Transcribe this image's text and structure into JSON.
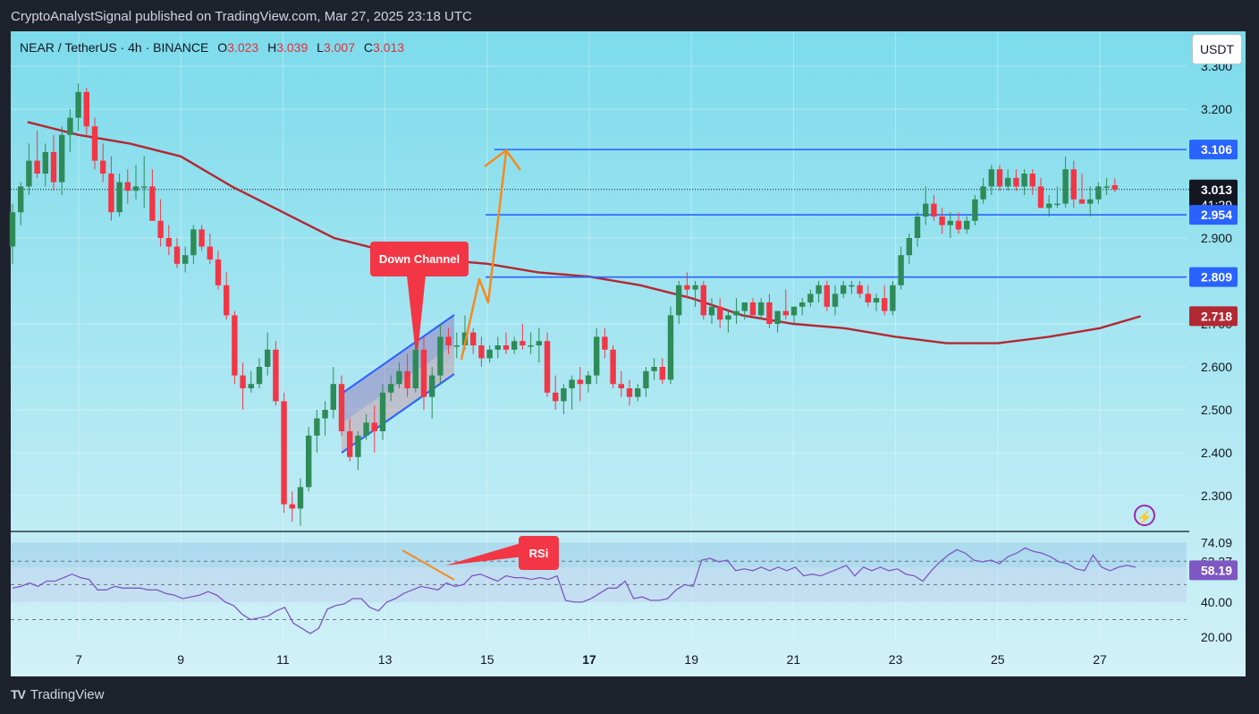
{
  "header": {
    "publisher_line": "CryptoAnalystSignal published on TradingView.com, Mar 27, 2025 23:18 UTC"
  },
  "symbol_info": {
    "pair": "NEAR / TetherUS · 4h · BINANCE",
    "open_label": "O",
    "open": "3.023",
    "high_label": "H",
    "high": "3.039",
    "low_label": "L",
    "low": "3.007",
    "close_label": "C",
    "close": "3.013"
  },
  "unit": "USDT",
  "annotations": {
    "down_channel": "Down Channel",
    "rsi": "RSi"
  },
  "footer": {
    "brand": "TradingView",
    "logo_mark": "TV"
  },
  "colors": {
    "up": "#2e8b57",
    "down": "#f23645",
    "ma": "#b22833",
    "level": "#2962ff",
    "rsi": "#7e57c2",
    "arrow": "#f7891e"
  },
  "chart_data": [
    {
      "type": "candlestick",
      "title": "",
      "x_ticks": [
        "7",
        "9",
        "11",
        "13",
        "15",
        "17",
        "19",
        "21",
        "23",
        "25",
        "27"
      ],
      "y_ticks": [
        "3.300",
        "3.200",
        "2.900",
        "2.700",
        "2.600",
        "2.500",
        "2.400",
        "2.300"
      ],
      "ylim": [
        2.22,
        3.4
      ],
      "horizontal_levels": [
        3.106,
        2.954,
        2.809
      ],
      "price_labels": [
        {
          "value": 3.106,
          "text": "3.106",
          "style": "level"
        },
        {
          "value": 3.013,
          "text": "3.013",
          "sub": "41:29",
          "style": "last"
        },
        {
          "value": 2.954,
          "text": "2.954",
          "style": "level"
        },
        {
          "value": 2.809,
          "text": "2.809",
          "style": "level"
        },
        {
          "value": 2.718,
          "text": "2.718",
          "style": "ma"
        }
      ],
      "last_price": 3.013,
      "countdown": "41:29",
      "candles": [
        [
          2.88,
          2.98,
          2.84,
          2.96
        ],
        [
          2.96,
          3.03,
          2.93,
          3.02
        ],
        [
          3.02,
          3.12,
          3.0,
          3.08
        ],
        [
          3.08,
          3.15,
          3.04,
          3.05
        ],
        [
          3.05,
          3.12,
          3.02,
          3.1
        ],
        [
          3.1,
          3.14,
          3.01,
          3.03
        ],
        [
          3.03,
          3.16,
          3.0,
          3.14
        ],
        [
          3.14,
          3.2,
          3.1,
          3.18
        ],
        [
          3.18,
          3.26,
          3.15,
          3.24
        ],
        [
          3.24,
          3.25,
          3.14,
          3.16
        ],
        [
          3.16,
          3.18,
          3.06,
          3.08
        ],
        [
          3.08,
          3.12,
          3.03,
          3.05
        ],
        [
          3.05,
          3.09,
          2.94,
          2.96
        ],
        [
          2.96,
          3.05,
          2.95,
          3.03
        ],
        [
          3.03,
          3.06,
          2.98,
          3.01
        ],
        [
          3.01,
          3.07,
          2.99,
          3.02
        ],
        [
          3.02,
          3.09,
          2.97,
          3.02
        ],
        [
          3.02,
          3.06,
          2.94,
          2.94
        ],
        [
          2.94,
          2.99,
          2.88,
          2.9
        ],
        [
          2.9,
          2.93,
          2.86,
          2.88
        ],
        [
          2.88,
          2.9,
          2.83,
          2.84
        ],
        [
          2.84,
          2.88,
          2.82,
          2.86
        ],
        [
          2.86,
          2.93,
          2.84,
          2.92
        ],
        [
          2.92,
          2.93,
          2.87,
          2.88
        ],
        [
          2.88,
          2.91,
          2.84,
          2.85
        ],
        [
          2.85,
          2.87,
          2.78,
          2.79
        ],
        [
          2.79,
          2.82,
          2.71,
          2.72
        ],
        [
          2.72,
          2.73,
          2.56,
          2.58
        ],
        [
          2.58,
          2.61,
          2.5,
          2.55
        ],
        [
          2.55,
          2.59,
          2.54,
          2.56
        ],
        [
          2.56,
          2.62,
          2.55,
          2.6
        ],
        [
          2.6,
          2.68,
          2.58,
          2.64
        ],
        [
          2.64,
          2.66,
          2.51,
          2.52
        ],
        [
          2.52,
          2.54,
          2.26,
          2.28
        ],
        [
          2.28,
          2.31,
          2.24,
          2.27
        ],
        [
          2.27,
          2.34,
          2.23,
          2.32
        ],
        [
          2.32,
          2.46,
          2.31,
          2.44
        ],
        [
          2.44,
          2.5,
          2.4,
          2.48
        ],
        [
          2.48,
          2.52,
          2.44,
          2.5
        ],
        [
          2.5,
          2.6,
          2.48,
          2.56
        ],
        [
          2.56,
          2.58,
          2.44,
          2.45
        ],
        [
          2.45,
          2.48,
          2.38,
          2.39
        ],
        [
          2.39,
          2.45,
          2.36,
          2.44
        ],
        [
          2.44,
          2.49,
          2.43,
          2.47
        ],
        [
          2.47,
          2.51,
          2.4,
          2.45
        ],
        [
          2.45,
          2.56,
          2.43,
          2.54
        ],
        [
          2.54,
          2.58,
          2.52,
          2.56
        ],
        [
          2.56,
          2.61,
          2.55,
          2.59
        ],
        [
          2.59,
          2.63,
          2.53,
          2.55
        ],
        [
          2.55,
          2.66,
          2.54,
          2.64
        ],
        [
          2.64,
          2.67,
          2.5,
          2.53
        ],
        [
          2.53,
          2.6,
          2.48,
          2.58
        ],
        [
          2.58,
          2.7,
          2.56,
          2.67
        ],
        [
          2.67,
          2.69,
          2.63,
          2.65
        ],
        [
          2.65,
          2.68,
          2.62,
          2.65
        ],
        [
          2.65,
          2.72,
          2.64,
          2.68
        ],
        [
          2.68,
          2.69,
          2.63,
          2.65
        ],
        [
          2.65,
          2.67,
          2.6,
          2.62
        ],
        [
          2.62,
          2.65,
          2.61,
          2.64
        ],
        [
          2.64,
          2.67,
          2.62,
          2.65
        ],
        [
          2.65,
          2.68,
          2.63,
          2.64
        ],
        [
          2.64,
          2.67,
          2.63,
          2.66
        ],
        [
          2.66,
          2.7,
          2.64,
          2.65
        ],
        [
          2.65,
          2.68,
          2.63,
          2.65
        ],
        [
          2.65,
          2.69,
          2.61,
          2.66
        ],
        [
          2.66,
          2.68,
          2.53,
          2.54
        ],
        [
          2.54,
          2.58,
          2.5,
          2.52
        ],
        [
          2.52,
          2.56,
          2.49,
          2.55
        ],
        [
          2.55,
          2.58,
          2.5,
          2.57
        ],
        [
          2.57,
          2.6,
          2.52,
          2.56
        ],
        [
          2.56,
          2.59,
          2.54,
          2.58
        ],
        [
          2.58,
          2.69,
          2.56,
          2.67
        ],
        [
          2.67,
          2.69,
          2.62,
          2.64
        ],
        [
          2.64,
          2.65,
          2.55,
          2.56
        ],
        [
          2.56,
          2.59,
          2.53,
          2.55
        ],
        [
          2.55,
          2.57,
          2.51,
          2.53
        ],
        [
          2.53,
          2.56,
          2.52,
          2.55
        ],
        [
          2.55,
          2.6,
          2.53,
          2.59
        ],
        [
          2.59,
          2.62,
          2.57,
          2.6
        ],
        [
          2.6,
          2.62,
          2.56,
          2.57
        ],
        [
          2.57,
          2.74,
          2.56,
          2.72
        ],
        [
          2.72,
          2.8,
          2.7,
          2.79
        ],
        [
          2.79,
          2.82,
          2.76,
          2.78
        ],
        [
          2.78,
          2.8,
          2.74,
          2.79
        ],
        [
          2.79,
          2.8,
          2.71,
          2.72
        ],
        [
          2.72,
          2.76,
          2.7,
          2.74
        ],
        [
          2.74,
          2.76,
          2.69,
          2.71
        ],
        [
          2.71,
          2.73,
          2.68,
          2.72
        ],
        [
          2.72,
          2.76,
          2.7,
          2.73
        ],
        [
          2.73,
          2.75,
          2.71,
          2.75
        ],
        [
          2.75,
          2.76,
          2.72,
          2.72
        ],
        [
          2.72,
          2.76,
          2.71,
          2.75
        ],
        [
          2.75,
          2.77,
          2.69,
          2.7
        ],
        [
          2.7,
          2.73,
          2.68,
          2.73
        ],
        [
          2.73,
          2.78,
          2.71,
          2.72
        ],
        [
          2.72,
          2.74,
          2.7,
          2.74
        ],
        [
          2.74,
          2.76,
          2.72,
          2.75
        ],
        [
          2.75,
          2.78,
          2.74,
          2.77
        ],
        [
          2.77,
          2.8,
          2.75,
          2.79
        ],
        [
          2.79,
          2.8,
          2.73,
          2.74
        ],
        [
          2.74,
          2.79,
          2.72,
          2.77
        ],
        [
          2.77,
          2.8,
          2.76,
          2.79
        ],
        [
          2.79,
          2.8,
          2.77,
          2.79
        ],
        [
          2.79,
          2.8,
          2.76,
          2.77
        ],
        [
          2.77,
          2.79,
          2.74,
          2.75
        ],
        [
          2.75,
          2.77,
          2.73,
          2.76
        ],
        [
          2.76,
          2.79,
          2.72,
          2.73
        ],
        [
          2.73,
          2.8,
          2.72,
          2.79
        ],
        [
          2.79,
          2.88,
          2.78,
          2.86
        ],
        [
          2.86,
          2.91,
          2.84,
          2.9
        ],
        [
          2.9,
          2.96,
          2.88,
          2.95
        ],
        [
          2.95,
          3.02,
          2.93,
          2.98
        ],
        [
          2.98,
          3.0,
          2.94,
          2.95
        ],
        [
          2.95,
          2.97,
          2.91,
          2.93
        ],
        [
          2.93,
          2.96,
          2.9,
          2.94
        ],
        [
          2.94,
          2.96,
          2.91,
          2.92
        ],
        [
          2.92,
          2.95,
          2.91,
          2.94
        ],
        [
          2.94,
          3.0,
          2.93,
          2.99
        ],
        [
          2.99,
          3.04,
          2.98,
          3.02
        ],
        [
          3.02,
          3.07,
          3.0,
          3.06
        ],
        [
          3.06,
          3.07,
          3.01,
          3.02
        ],
        [
          3.02,
          3.06,
          3.01,
          3.04
        ],
        [
          3.04,
          3.06,
          3.01,
          3.02
        ],
        [
          3.02,
          3.06,
          3.0,
          3.05
        ],
        [
          3.05,
          3.06,
          3.0,
          3.02
        ],
        [
          3.02,
          3.04,
          2.97,
          2.97
        ],
        [
          2.97,
          3.0,
          2.95,
          2.98
        ],
        [
          2.98,
          3.02,
          2.97,
          2.98
        ],
        [
          2.98,
          3.09,
          2.97,
          3.06
        ],
        [
          3.06,
          3.08,
          2.97,
          2.99
        ],
        [
          2.99,
          3.05,
          2.98,
          2.98
        ],
        [
          2.98,
          3.02,
          2.95,
          2.99
        ],
        [
          2.99,
          3.03,
          2.98,
          3.02
        ],
        [
          3.02,
          3.04,
          3.0,
          3.02
        ],
        [
          3.023,
          3.039,
          3.007,
          3.013
        ]
      ],
      "moving_average": [
        {
          "day": 6.0,
          "value": 3.17
        },
        {
          "day": 7.0,
          "value": 3.14
        },
        {
          "day": 8.0,
          "value": 3.12
        },
        {
          "day": 9.0,
          "value": 3.09
        },
        {
          "day": 10.0,
          "value": 3.02
        },
        {
          "day": 11.0,
          "value": 2.96
        },
        {
          "day": 12.0,
          "value": 2.9
        },
        {
          "day": 13.0,
          "value": 2.87
        },
        {
          "day": 14.0,
          "value": 2.85
        },
        {
          "day": 15.0,
          "value": 2.84
        },
        {
          "day": 16.0,
          "value": 2.82
        },
        {
          "day": 17.0,
          "value": 2.81
        },
        {
          "day": 18.0,
          "value": 2.79
        },
        {
          "day": 19.0,
          "value": 2.76
        },
        {
          "day": 20.0,
          "value": 2.72
        },
        {
          "day": 21.0,
          "value": 2.7
        },
        {
          "day": 22.0,
          "value": 2.69
        },
        {
          "day": 23.0,
          "value": 2.67
        },
        {
          "day": 24.0,
          "value": 2.655
        },
        {
          "day": 25.0,
          "value": 2.655
        },
        {
          "day": 26.0,
          "value": 2.67
        },
        {
          "day": 27.0,
          "value": 2.69
        },
        {
          "day": 27.8,
          "value": 2.718
        }
      ]
    },
    {
      "type": "line",
      "series": [
        {
          "name": "",
          "values": [
            48,
            49,
            51,
            49,
            52,
            52,
            54,
            56,
            54,
            53,
            47,
            47,
            49,
            48,
            48,
            48,
            47,
            47,
            45,
            44,
            42,
            43,
            44,
            46,
            44,
            40,
            38,
            33,
            30,
            31,
            32,
            35,
            37,
            28,
            25,
            22,
            25,
            36,
            38,
            39,
            42,
            42,
            37,
            35,
            40,
            42,
            45,
            47,
            49,
            48,
            47,
            51,
            49,
            50,
            55,
            56,
            54,
            52,
            55,
            54,
            54,
            53,
            54,
            53,
            55,
            41,
            40,
            40,
            42,
            45,
            48,
            48,
            52,
            42,
            43,
            41,
            41,
            42,
            47,
            50,
            49,
            64,
            65,
            63,
            64,
            58,
            59,
            58,
            60,
            58,
            60,
            58,
            60,
            55,
            56,
            55,
            57,
            59,
            61,
            55,
            60,
            58,
            60,
            58,
            59,
            56,
            55,
            52,
            58,
            63,
            67,
            70,
            68,
            64,
            63,
            64,
            62,
            66,
            68,
            71,
            69,
            68,
            66,
            63,
            62,
            59,
            58,
            67,
            60,
            58,
            60,
            61,
            60
          ]
        }
      ],
      "y_ticks": [
        "74.09",
        "63.37",
        "40.00",
        "20.00"
      ],
      "ylim": [
        12,
        80
      ],
      "bands": [
        20,
        40,
        60,
        74.09
      ],
      "current_label": "58.19"
    }
  ]
}
